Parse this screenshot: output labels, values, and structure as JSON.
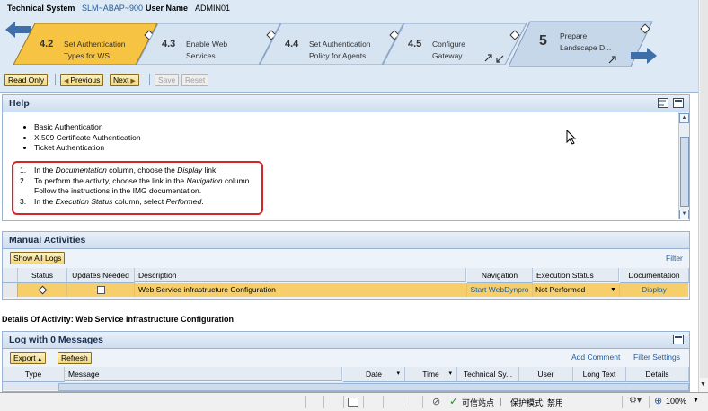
{
  "header": {
    "system_label": "Technical System",
    "system_value": "SLM~ABAP~900",
    "user_label": "User Name",
    "user_value": "ADMIN01"
  },
  "roadmap": {
    "back_arrow_icon": "arrow-left-icon",
    "forward_arrow_icon": "arrow-right-icon",
    "steps": [
      {
        "num": "4.2",
        "line1": "Set Authentication",
        "line2": "Types for WS",
        "active": true
      },
      {
        "num": "4.3",
        "line1": "Enable Web",
        "line2": "Services",
        "active": false
      },
      {
        "num": "4.4",
        "line1": "Set Authentication",
        "line2": "Policy for Agents",
        "active": false
      },
      {
        "num": "4.5",
        "line1": "Configure",
        "line2": "Gateway",
        "active": false
      },
      {
        "num": "5",
        "line1": "Prepare",
        "line2": "Landscape D...",
        "active": false
      }
    ]
  },
  "toolbar": {
    "read_only": "Read Only",
    "previous": "Previous",
    "next": "Next",
    "save": "Save",
    "reset": "Reset"
  },
  "help": {
    "title": "Help",
    "bullets": [
      "Basic Authentication",
      "X.509 Certificate Authentication",
      "Ticket Authentication"
    ],
    "steps": [
      {
        "n": "1.",
        "text": "In the Documentation column, choose the Display link."
      },
      {
        "n": "2.",
        "text": "To perform the activity, choose the link in the Navigation column."
      },
      {
        "n": "",
        "text": "Follow the instructions in the IMG documentation."
      },
      {
        "n": "3.",
        "text": "In the Execution Status column, select Performed."
      }
    ]
  },
  "manual": {
    "title": "Manual Activities",
    "show_all_logs": "Show All Logs",
    "filter": "Filter",
    "columns": [
      "Status",
      "Updates Needed",
      "Description",
      "Navigation",
      "Execution Status",
      "Documentation"
    ],
    "row": {
      "description": "Web Service infrastructure Configuration",
      "navigation": "Start WebDynpro",
      "execution_status": "Not Performed",
      "documentation": "Display"
    }
  },
  "details_label": "Details Of Activity: Web Service infrastructure Configuration",
  "log": {
    "title": "Log with 0 Messages",
    "export": "Export",
    "refresh": "Refresh",
    "add_comment": "Add Comment",
    "filter_settings": "Filter Settings",
    "columns": [
      "Type",
      "Message",
      "Date",
      "Time",
      "Technical Sy...",
      "User",
      "Long Text",
      "Details"
    ]
  },
  "statusbar": {
    "trusted_site": "可信站点",
    "protected_mode": "保护模式: 禁用",
    "zoom": "100%"
  },
  "colors": {
    "accent_active_step": "#f6c343",
    "row_highlight": "#f6cf6a",
    "link": "#1f5b9e",
    "note_border": "#d3262b"
  }
}
